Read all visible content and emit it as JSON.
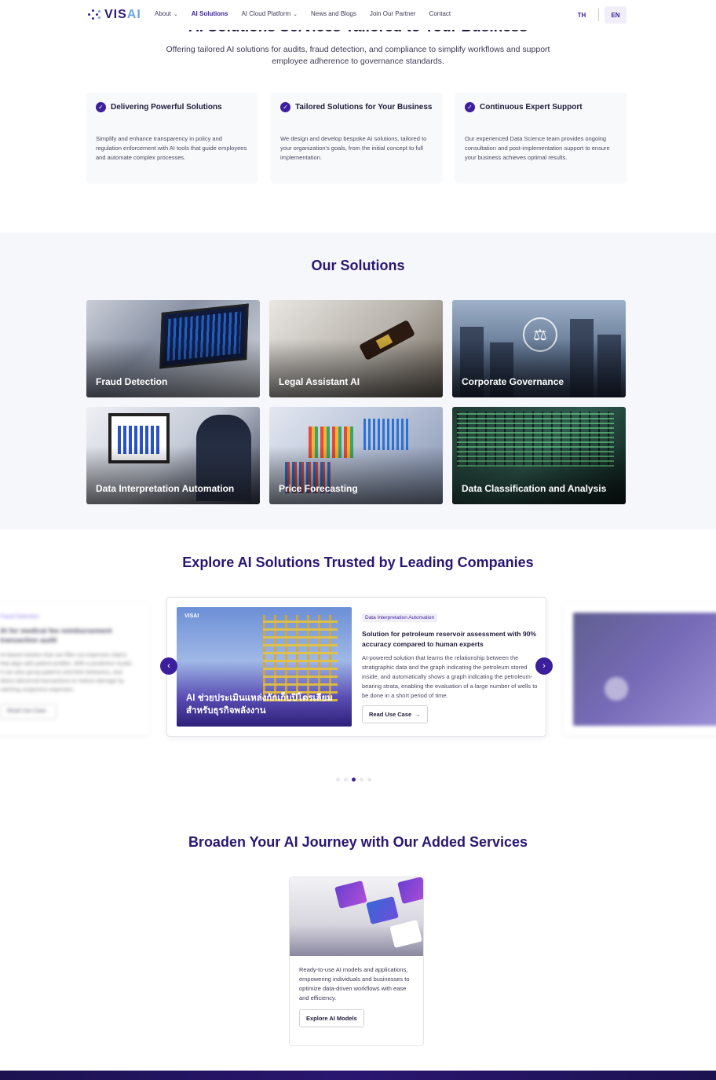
{
  "nav": {
    "logo_text_a": "VIS",
    "logo_text_b": "AI",
    "links": [
      {
        "label": "About",
        "has_chevron": true,
        "active": false
      },
      {
        "label": "AI Solutions",
        "has_chevron": false,
        "active": true
      },
      {
        "label": "AI Cloud Platform",
        "has_chevron": true,
        "active": false
      },
      {
        "label": "News and Blogs",
        "has_chevron": false,
        "active": false
      },
      {
        "label": "Join Our Partner",
        "has_chevron": false,
        "active": false
      },
      {
        "label": "Contact",
        "has_chevron": false,
        "active": false
      }
    ],
    "lang_th": "TH",
    "lang_en": "EN"
  },
  "hero": {
    "title": "AI Solutions Services Tailored to Your Business",
    "subtitle": "Offering tailored AI solutions for audits, fraud detection, and compliance to simplify workflows and support employee adherence to governance standards."
  },
  "features": [
    {
      "title": "Delivering Powerful Solutions",
      "desc": "Simplify and enhance transparency in policy and regulation enforcement with AI tools that guide employees and automate complex processes."
    },
    {
      "title": "Tailored Solutions for Your Business",
      "desc": "We design and develop bespoke AI solutions, tailored to your organization's goals, from the initial concept to full implementation."
    },
    {
      "title": "Continuous Expert Support",
      "desc": "Our experienced Data Science team provides ongoing consultation and post-implementation support to ensure your business achieves optimal results."
    }
  ],
  "solutions": {
    "title": "Our Solutions",
    "items": [
      "Fraud Detection",
      "Legal Assistant AI",
      "Corporate Governance",
      "Data Interpretation Automation",
      "Price Forecasting",
      "Data Classification and Analysis"
    ]
  },
  "explore": {
    "title": "Explore AI Solutions Trusted by Leading Companies",
    "left_card": {
      "tag": "Fraud Detection",
      "title": "AI for medical fee reimbursement transaction audit",
      "desc": "AI-based solution that can filter out expenses claims that align with patient profiles. With a predictive model, it can also group patterns and their behaviors, and detect abnormal transactions to reduce damage by catching suspicious expenses.",
      "button": "Read Use Case"
    },
    "main_card": {
      "image_logo": "VISAI",
      "image_text": "AI ช่วยประเมินแหล่งกักเก็บปิโตรเลียม สำหรับธุรกิจพลังงาน",
      "tag": "Data Interpretation Automation",
      "title": "Solution for petroleum reservoir assessment with 90% accuracy compared to human experts",
      "desc": "AI-powered solution that learns the relationship between the stratigraphic data and the graph indicating the petroleum stored inside, and automatically shows a graph indicating the petroleum-bearing strata, enabling the evaluation of a large number of wells to be done in a short period of time.",
      "button": "Read Use Case"
    },
    "prev_icon": "‹",
    "next_icon": "›",
    "dot_count": 5,
    "active_dot": 2
  },
  "services": {
    "title": "Broaden Your AI Journey with Our Added Services",
    "card_desc": "Ready-to-use AI models and applications, empowering individuals and businesses to optimize data-driven workflows with ease and efficiency.",
    "button": "Explore AI Models"
  },
  "colors": {
    "brand": "#3b1f9c",
    "heading": "#2a1670",
    "section_bg": "#f5f7fa"
  }
}
